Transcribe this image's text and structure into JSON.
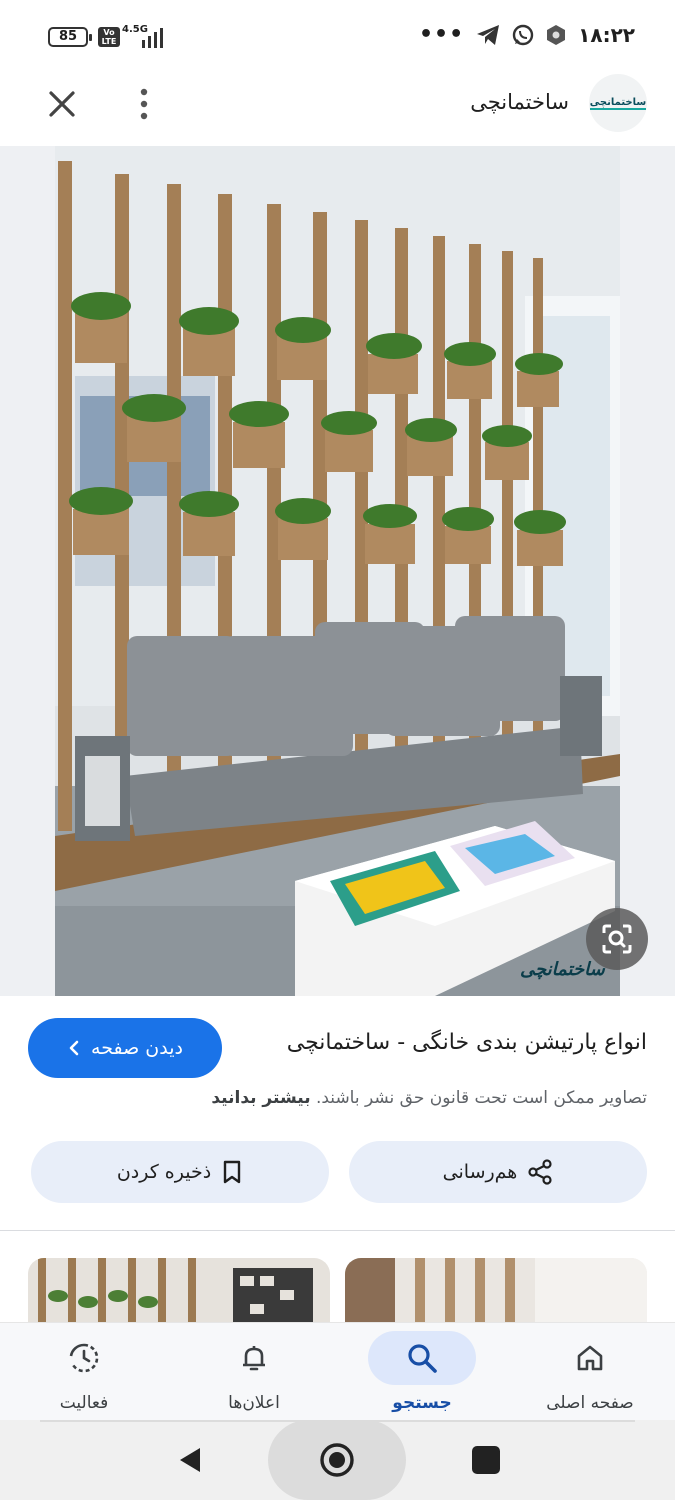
{
  "status_bar": {
    "battery": "85",
    "volte": "Vo LTE",
    "network": "4.5G",
    "overflow": "•••",
    "time": "۱۸:۲۲"
  },
  "top_bar": {
    "site_name": "ساختمانچی",
    "logo_text": "ساختمانچی"
  },
  "image": {
    "watermark": "ساختمانچی"
  },
  "info": {
    "title": "انواع پارتیشن بندی خانگی - ساختمانچی",
    "visit_label": "دیدن صفحه",
    "copyright_text": "تصاویر ممکن است تحت قانون حق نشر باشند.",
    "learn_more": "بیشتر بدانید",
    "share_label": "هم‌رسانی",
    "save_label": "ذخیره کردن"
  },
  "nav": {
    "home": "صفحه اصلی",
    "search": "جستجو",
    "notifications": "اعلان‌ها",
    "activity": "فعالیت",
    "active": "search"
  },
  "colors": {
    "accent": "#1a73e8",
    "pill_bg": "#e8eef9",
    "nav_active_bg": "#dde7fb"
  }
}
